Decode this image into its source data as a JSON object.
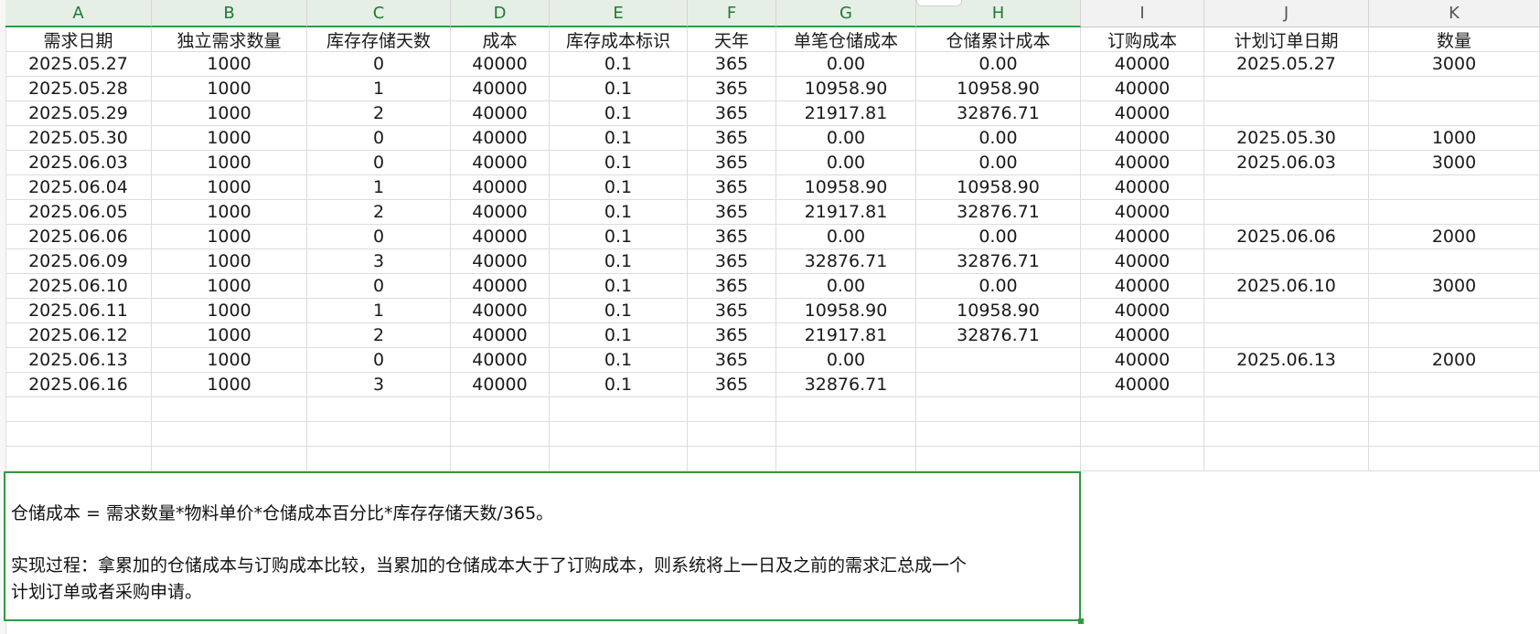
{
  "columns": [
    "A",
    "B",
    "C",
    "D",
    "E",
    "F",
    "G",
    "H",
    "I",
    "J",
    "K"
  ],
  "selected_columns": [
    "A",
    "B",
    "C",
    "D",
    "E",
    "F",
    "G",
    "H"
  ],
  "table": {
    "headers": [
      "需求日期",
      "独立需求数量",
      "库存存储天数",
      "成本",
      "库存成本标识",
      "天年",
      "单笔仓储成本",
      "仓储累计成本",
      "订购成本",
      "计划订单日期",
      "数量"
    ],
    "rows": [
      [
        "2025.05.27",
        "1000",
        "0",
        "40000",
        "0.1",
        "365",
        "0.00",
        "0.00",
        "40000",
        "2025.05.27",
        "3000"
      ],
      [
        "2025.05.28",
        "1000",
        "1",
        "40000",
        "0.1",
        "365",
        "10958.90",
        "10958.90",
        "40000",
        "",
        ""
      ],
      [
        "2025.05.29",
        "1000",
        "2",
        "40000",
        "0.1",
        "365",
        "21917.81",
        "32876.71",
        "40000",
        "",
        ""
      ],
      [
        "2025.05.30",
        "1000",
        "0",
        "40000",
        "0.1",
        "365",
        "0.00",
        "0.00",
        "40000",
        "2025.05.30",
        "1000"
      ],
      [
        "2025.06.03",
        "1000",
        "0",
        "40000",
        "0.1",
        "365",
        "0.00",
        "0.00",
        "40000",
        "2025.06.03",
        "3000"
      ],
      [
        "2025.06.04",
        "1000",
        "1",
        "40000",
        "0.1",
        "365",
        "10958.90",
        "10958.90",
        "40000",
        "",
        ""
      ],
      [
        "2025.06.05",
        "1000",
        "2",
        "40000",
        "0.1",
        "365",
        "21917.81",
        "32876.71",
        "40000",
        "",
        ""
      ],
      [
        "2025.06.06",
        "1000",
        "0",
        "40000",
        "0.1",
        "365",
        "0.00",
        "0.00",
        "40000",
        "2025.06.06",
        "2000"
      ],
      [
        "2025.06.09",
        "1000",
        "3",
        "40000",
        "0.1",
        "365",
        "32876.71",
        "32876.71",
        "40000",
        "",
        ""
      ],
      [
        "2025.06.10",
        "1000",
        "0",
        "40000",
        "0.1",
        "365",
        "0.00",
        "0.00",
        "40000",
        "2025.06.10",
        "3000"
      ],
      [
        "2025.06.11",
        "1000",
        "1",
        "40000",
        "0.1",
        "365",
        "10958.90",
        "10958.90",
        "40000",
        "",
        ""
      ],
      [
        "2025.06.12",
        "1000",
        "2",
        "40000",
        "0.1",
        "365",
        "21917.81",
        "32876.71",
        "40000",
        "",
        ""
      ],
      [
        "2025.06.13",
        "1000",
        "0",
        "40000",
        "0.1",
        "365",
        "0.00",
        "",
        "40000",
        "2025.06.13",
        "2000"
      ],
      [
        "2025.06.16",
        "1000",
        "3",
        "40000",
        "0.1",
        "365",
        "32876.71",
        "",
        "40000",
        "",
        ""
      ]
    ]
  },
  "note": {
    "line1": "仓储成本 = 需求数量*物料单价*仓储成本百分比*库存存储天数/365。",
    "line2": "实现过程：拿累加的仓储成本与订购成本比较，当累加的仓储成本大于了订购成本，则系统将上一日及之前的需求汇总成一个",
    "line3": "计划订单或者采购申请。"
  },
  "colors": {
    "accent": "#2e9b44",
    "gridline": "#dcdcdc"
  }
}
